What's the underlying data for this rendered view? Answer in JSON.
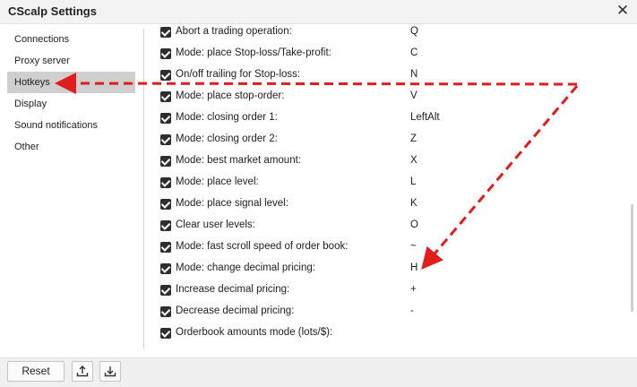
{
  "window": {
    "title": "CScalp Settings",
    "close_glyph": "✕"
  },
  "sidebar": {
    "items": [
      {
        "label": "Connections",
        "active": false
      },
      {
        "label": "Proxy server",
        "active": false
      },
      {
        "label": "Hotkeys",
        "active": true
      },
      {
        "label": "Display",
        "active": false
      },
      {
        "label": "Sound notifications",
        "active": false
      },
      {
        "label": "Other",
        "active": false
      }
    ]
  },
  "hotkeys": [
    {
      "label": "Abort a trading operation:",
      "key": "Q",
      "checked": true
    },
    {
      "label": "Mode: place Stop-loss/Take-profit:",
      "key": "C",
      "checked": true
    },
    {
      "label": "On/off trailing for Stop-loss:",
      "key": "N",
      "checked": true
    },
    {
      "label": "Mode: place stop-order:",
      "key": "V",
      "checked": true
    },
    {
      "label": "Mode: closing order 1:",
      "key": "LeftAlt",
      "checked": true
    },
    {
      "label": "Mode: closing order 2:",
      "key": "Z",
      "checked": true
    },
    {
      "label": "Mode: best market amount:",
      "key": "X",
      "checked": true
    },
    {
      "label": "Mode: place level:",
      "key": "L",
      "checked": true
    },
    {
      "label": "Mode: place signal level:",
      "key": "K",
      "checked": true
    },
    {
      "label": "Clear user levels:",
      "key": "O",
      "checked": true
    },
    {
      "label": "Mode: fast scroll speed of order book:",
      "key": "~",
      "checked": true
    },
    {
      "label": "Mode: change decimal pricing:",
      "key": "H",
      "checked": true
    },
    {
      "label": "Increase decimal pricing:",
      "key": "+",
      "checked": true
    },
    {
      "label": "Decrease decimal pricing:",
      "key": "-",
      "checked": true
    },
    {
      "label": "Orderbook amounts mode (lots/$):",
      "key": "",
      "checked": true
    }
  ],
  "footer": {
    "reset_label": "Reset",
    "export_icon": "upload-icon",
    "import_icon": "download-icon"
  },
  "annotation_color": "#e01c1c"
}
